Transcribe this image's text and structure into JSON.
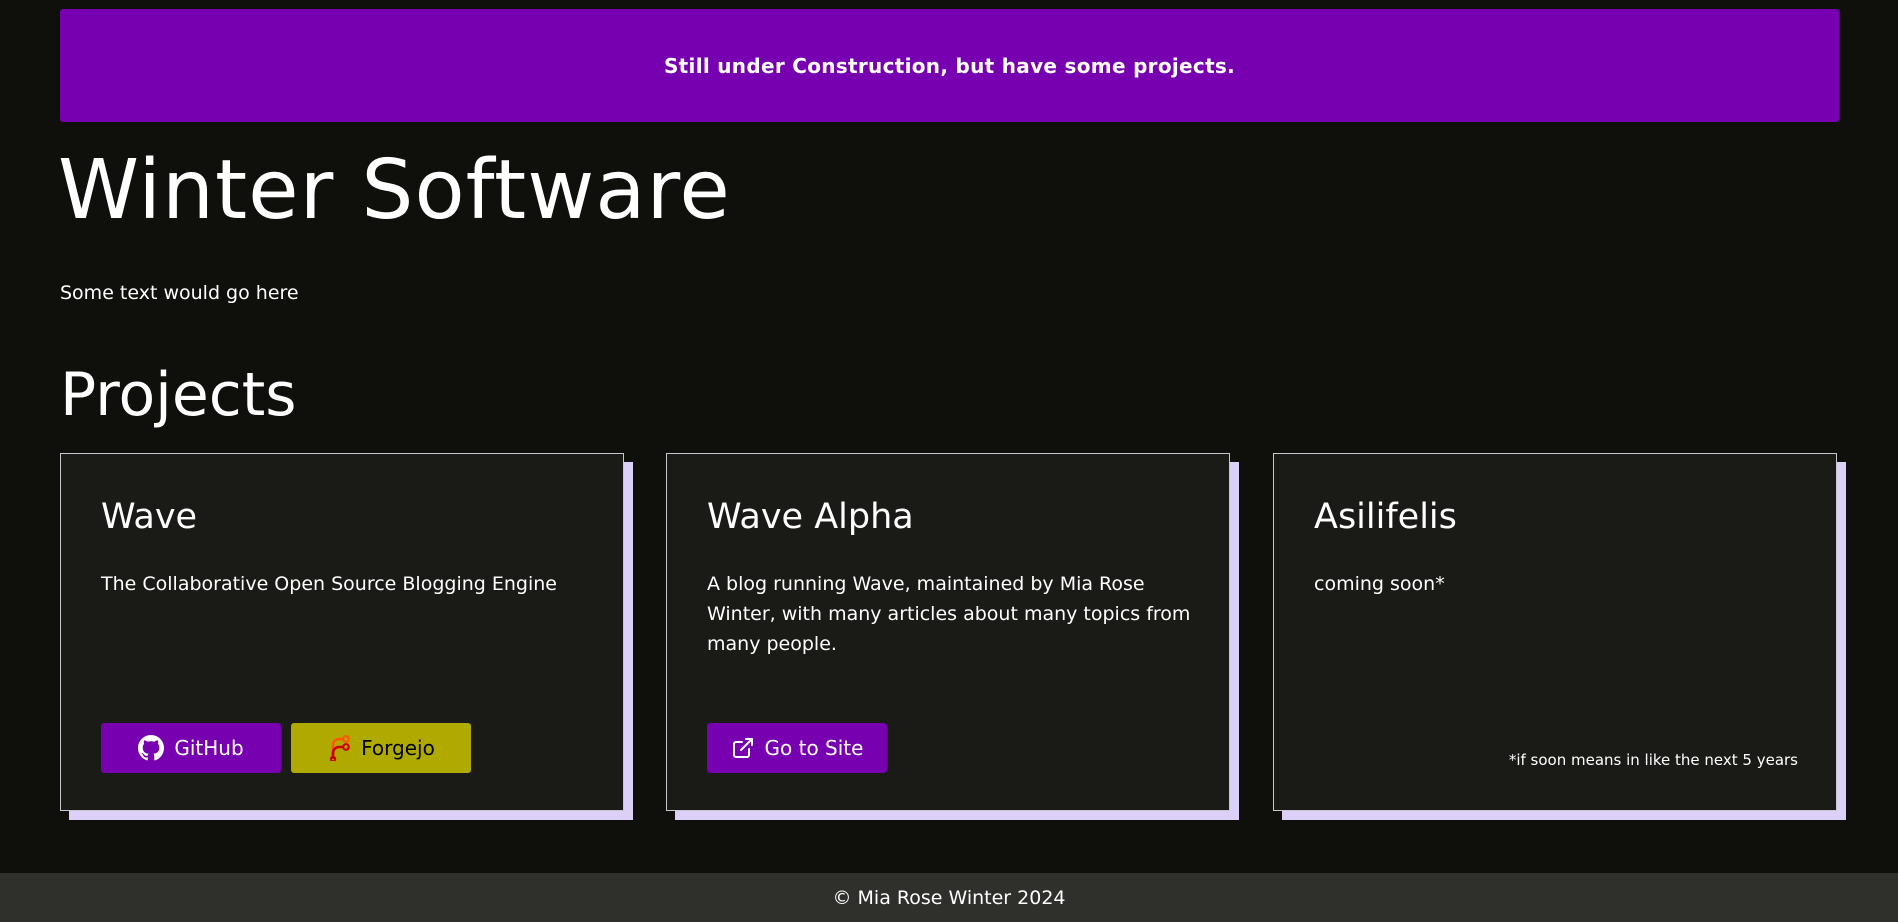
{
  "banner": {
    "text": "Still under Construction, but have some projects."
  },
  "header": {
    "title": "Winter Software",
    "intro": "Some text would go here"
  },
  "projects": {
    "heading": "Projects",
    "cards": [
      {
        "title": "Wave",
        "description": "The Collaborative Open Source Blogging Engine",
        "buttons": [
          {
            "label": "GitHub",
            "icon": "github-icon",
            "color": "#7700b0"
          },
          {
            "label": "Forgejo",
            "icon": "forgejo-icon",
            "color": "#b0aa00"
          }
        ]
      },
      {
        "title": "Wave Alpha",
        "description": "A blog running Wave, maintained by Mia Rose Winter, with many articles about many topics from many people.",
        "buttons": [
          {
            "label": "Go to Site",
            "icon": "external-link-icon",
            "color": "#7700b0"
          }
        ]
      },
      {
        "title": "Asilifelis",
        "description": "coming soon*",
        "footnote": "*if soon means in like the next 5 years"
      }
    ]
  },
  "footer": {
    "text": "© Mia Rose Winter 2024"
  },
  "colors": {
    "background": "#0f100c",
    "accent_purple": "#7700b0",
    "accent_yellow": "#b0aa00",
    "card_background": "#1a1a16",
    "card_shadow": "#ddd0f8",
    "footer_background": "#2f302b"
  }
}
